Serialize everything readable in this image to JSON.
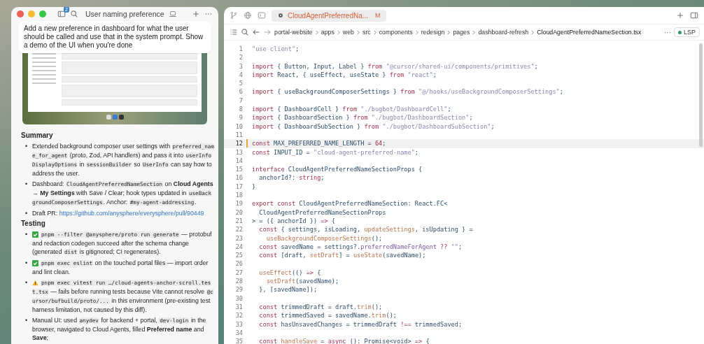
{
  "chat_window": {
    "title": "User naming preference",
    "badge": "2",
    "prompt": "Add a new preference in dashboard for what the user should be called and use that in the system prompt. Show a demo of the UI when you're done",
    "sections": [
      {
        "heading": "Summary",
        "items": [
          {
            "kind": "plain",
            "bullet": "•",
            "segments": [
              {
                "kind": "text",
                "text": "Extended background composer user settings with "
              },
              {
                "kind": "code",
                "text": "preferred_name_for_agent"
              },
              {
                "kind": "text",
                "text": " (proto, Zod, API handlers) and pass it into "
              },
              {
                "kind": "code",
                "text": "userInfoDisplayOptions"
              },
              {
                "kind": "text",
                "text": " in "
              },
              {
                "kind": "code",
                "text": "sessionBuilder"
              },
              {
                "kind": "text",
                "text": " so "
              },
              {
                "kind": "code",
                "text": "UserInfo"
              },
              {
                "kind": "text",
                "text": " can say how to address the user."
              }
            ]
          },
          {
            "kind": "plain",
            "bullet": "•",
            "segments": [
              {
                "kind": "text",
                "text": "Dashboard: "
              },
              {
                "kind": "code",
                "text": "CloudAgentPreferredNameSection"
              },
              {
                "kind": "text",
                "text": " on "
              },
              {
                "kind": "bold",
                "text": "Cloud Agents → My Settings"
              },
              {
                "kind": "text",
                "text": " with Save / Clear; hook types updated in "
              },
              {
                "kind": "code",
                "text": "useBackgroundComposerSettings"
              },
              {
                "kind": "text",
                "text": ". Anchor: "
              },
              {
                "kind": "code",
                "text": "#my-agent-addressing"
              },
              {
                "kind": "text",
                "text": "."
              }
            ]
          },
          {
            "kind": "plain",
            "bullet": "•",
            "segments": [
              {
                "kind": "text",
                "text": "Draft PR: "
              },
              {
                "kind": "link",
                "text": "https://github.com/anysphere/everysphere/pull/90449"
              }
            ]
          }
        ]
      },
      {
        "heading": "Testing",
        "items": [
          {
            "kind": "pass",
            "bullet": "•",
            "segments": [
              {
                "kind": "code",
                "text": "pnpm --filter @anysphere/proto run generate"
              },
              {
                "kind": "text",
                "text": " — protobuf and redaction codegen succeed after the schema change (generated "
              },
              {
                "kind": "code",
                "text": "dist"
              },
              {
                "kind": "text",
                "text": " is gitignored; CI regenerates)."
              }
            ]
          },
          {
            "kind": "pass",
            "bullet": "•",
            "segments": [
              {
                "kind": "code",
                "text": "pnpm exec eslint"
              },
              {
                "kind": "text",
                "text": " on the touched portal files — import order and lint clean."
              }
            ]
          },
          {
            "kind": "warn",
            "bullet": "•",
            "segments": [
              {
                "kind": "code",
                "text": "pnpm exec vitest run …/cloud-agents-anchor-scroll.test.tsx"
              },
              {
                "kind": "text",
                "text": " — fails before running tests because Vite cannot resolve "
              },
              {
                "kind": "code",
                "text": "@cursor/bufbuild/proto/..."
              },
              {
                "kind": "text",
                "text": " in this environment (pre-existing test harness limitation, not caused by this diff)."
              }
            ]
          },
          {
            "kind": "plain",
            "bullet": "•",
            "segments": [
              {
                "kind": "text",
                "text": "Manual UI: used "
              },
              {
                "kind": "code",
                "text": "anydev"
              },
              {
                "kind": "text",
                "text": " for backend + portal, "
              },
              {
                "kind": "code",
                "text": "dev-login"
              },
              {
                "kind": "text",
                "text": " in the browser, navigated to Cloud Agents, filled "
              },
              {
                "kind": "bold",
                "text": "Preferred name"
              },
              {
                "kind": "text",
                "text": " and "
              },
              {
                "kind": "bold",
                "text": "Save"
              },
              {
                "kind": "text",
                "text": ";"
              }
            ]
          }
        ]
      }
    ]
  },
  "editor": {
    "tabs": [
      {
        "label": "CloudAgentPreferredNa...",
        "status": "M",
        "selected": true
      }
    ],
    "breadcrumbs": [
      "portal-website",
      "apps",
      "web",
      "src",
      "components",
      "redesign",
      "pages",
      "dashboard-refresh",
      "CloudAgentPreferredNameSection.tsx"
    ],
    "more": "···",
    "lsp": {
      "label": "LSP",
      "color": "#2e9a6a"
    },
    "lines": [
      {
        "number": "1",
        "selected": false,
        "tokens": [
          {
            "kind": "str",
            "text": "\"use client\""
          },
          {
            "kind": "p",
            "text": ";"
          }
        ]
      },
      {
        "number": "2",
        "selected": false
      },
      {
        "number": "3",
        "selected": false,
        "tokens": [
          {
            "kind": "kw",
            "text": "import"
          },
          {
            "kind": "p",
            "text": " { Button, Input, Label } "
          },
          {
            "kind": "kw",
            "text": "from "
          },
          {
            "kind": "str",
            "text": "\"@cursor/shared-ui/components/primitives\""
          },
          {
            "kind": "p",
            "text": ";"
          }
        ]
      },
      {
        "number": "4",
        "selected": false,
        "tokens": [
          {
            "kind": "kw",
            "text": "import"
          },
          {
            "kind": "p",
            "text": " React, { useEffect, useState } "
          },
          {
            "kind": "kw",
            "text": "from "
          },
          {
            "kind": "str",
            "text": "\"react\""
          },
          {
            "kind": "p",
            "text": ";"
          }
        ]
      },
      {
        "number": "5",
        "selected": false
      },
      {
        "number": "6",
        "selected": false,
        "tokens": [
          {
            "kind": "kw",
            "text": "import"
          },
          {
            "kind": "p",
            "text": " { useBackgroundComposerSettings } "
          },
          {
            "kind": "kw",
            "text": "from "
          },
          {
            "kind": "str",
            "text": "\"@/hooks/useBackgroundComposerSettings\""
          },
          {
            "kind": "p",
            "text": ";"
          }
        ]
      },
      {
        "number": "7",
        "selected": false
      },
      {
        "number": "8",
        "selected": false,
        "tokens": [
          {
            "kind": "kw",
            "text": "import"
          },
          {
            "kind": "p",
            "text": " { DashboardCell } "
          },
          {
            "kind": "kw",
            "text": "from "
          },
          {
            "kind": "str",
            "text": "\"./bugbot/DashboardCell\""
          },
          {
            "kind": "p",
            "text": ";"
          }
        ]
      },
      {
        "number": "9",
        "selected": false,
        "tokens": [
          {
            "kind": "kw",
            "text": "import"
          },
          {
            "kind": "p",
            "text": " { DashboardSection } "
          },
          {
            "kind": "kw",
            "text": "from "
          },
          {
            "kind": "str",
            "text": "\"./bugbot/DashboardSection\""
          },
          {
            "kind": "p",
            "text": ";"
          }
        ]
      },
      {
        "number": "10",
        "selected": false,
        "tokens": [
          {
            "kind": "kw",
            "text": "import"
          },
          {
            "kind": "p",
            "text": " { DashboardSubSection } "
          },
          {
            "kind": "kw",
            "text": "from "
          },
          {
            "kind": "str",
            "text": "\"./bugbot/DashboardSubSection\""
          },
          {
            "kind": "p",
            "text": ";"
          }
        ]
      },
      {
        "number": "11",
        "selected": false
      },
      {
        "number": "12",
        "selected": true,
        "tokens": [
          {
            "kind": "kw",
            "text": "const"
          },
          {
            "kind": "p",
            "text": " MAX_PREFERRED_NAME_LENGTH = "
          },
          {
            "kind": "num",
            "text": "64"
          },
          {
            "kind": "p",
            "text": ";"
          }
        ]
      },
      {
        "number": "13",
        "selected": false,
        "tokens": [
          {
            "kind": "kw",
            "text": "const"
          },
          {
            "kind": "p",
            "text": " INPUT_ID = "
          },
          {
            "kind": "str",
            "text": "\"cloud-agent-preferred-name\""
          },
          {
            "kind": "p",
            "text": ";"
          }
        ]
      },
      {
        "number": "14",
        "selected": false
      },
      {
        "number": "15",
        "selected": false,
        "tokens": [
          {
            "kind": "kw",
            "text": "interface"
          },
          {
            "kind": "p",
            "text": " CloudAgentPreferredNameSectionProps {"
          }
        ]
      },
      {
        "number": "16",
        "selected": false,
        "tokens": [
          {
            "kind": "p",
            "text": "  anchorId?: "
          },
          {
            "kind": "kw",
            "text": "string"
          },
          {
            "kind": "p",
            "text": ";"
          }
        ]
      },
      {
        "number": "17",
        "selected": false,
        "tokens": [
          {
            "kind": "p",
            "text": "}"
          }
        ]
      },
      {
        "number": "18",
        "selected": false
      },
      {
        "number": "19",
        "selected": false,
        "tokens": [
          {
            "kind": "kw",
            "text": "export const"
          },
          {
            "kind": "p",
            "text": " CloudAgentPreferredNameSection: React.FC<"
          }
        ]
      },
      {
        "number": "20",
        "selected": false,
        "tokens": [
          {
            "kind": "p",
            "text": "  CloudAgentPreferredNameSectionProps"
          }
        ]
      },
      {
        "number": "21",
        "selected": false,
        "tokens": [
          {
            "kind": "p",
            "text": "> = ({ anchorId }) "
          },
          {
            "kind": "kw",
            "text": "=>"
          },
          {
            "kind": "p",
            "text": " {"
          }
        ]
      },
      {
        "number": "22",
        "selected": false,
        "tokens": [
          {
            "kind": "kw",
            "text": "  const"
          },
          {
            "kind": "p",
            "text": " { settings, isLoading, "
          },
          {
            "kind": "fn",
            "text": "updateSettings"
          },
          {
            "kind": "p",
            "text": ", isUpdating } ="
          }
        ]
      },
      {
        "number": "23",
        "selected": false,
        "tokens": [
          {
            "kind": "fn",
            "text": "    useBackgroundComposerSettings"
          },
          {
            "kind": "p",
            "text": "();"
          }
        ]
      },
      {
        "number": "24",
        "selected": false,
        "tokens": [
          {
            "kind": "kw",
            "text": "  const"
          },
          {
            "kind": "p",
            "text": " savedName = settings?."
          },
          {
            "kind": "prop",
            "text": "preferredNameForAgent"
          },
          {
            "kind": "kw",
            "text": " ?? "
          },
          {
            "kind": "str",
            "text": "\"\""
          },
          {
            "kind": "p",
            "text": ";"
          }
        ]
      },
      {
        "number": "25",
        "selected": false,
        "tokens": [
          {
            "kind": "kw",
            "text": "  const"
          },
          {
            "kind": "p",
            "text": " [draft, "
          },
          {
            "kind": "fn",
            "text": "setDraft"
          },
          {
            "kind": "p",
            "text": "] = "
          },
          {
            "kind": "fn",
            "text": "useState"
          },
          {
            "kind": "p",
            "text": "(savedName);"
          }
        ]
      },
      {
        "number": "26",
        "selected": false
      },
      {
        "number": "27",
        "selected": false,
        "tokens": [
          {
            "kind": "fn",
            "text": "  useEffect"
          },
          {
            "kind": "p",
            "text": "(() "
          },
          {
            "kind": "kw",
            "text": "=>"
          },
          {
            "kind": "p",
            "text": " {"
          }
        ]
      },
      {
        "number": "28",
        "selected": false,
        "tokens": [
          {
            "kind": "fn",
            "text": "    setDraft"
          },
          {
            "kind": "p",
            "text": "(savedName);"
          }
        ]
      },
      {
        "number": "29",
        "selected": false,
        "tokens": [
          {
            "kind": "p",
            "text": "  }, [savedName]);"
          }
        ]
      },
      {
        "number": "30",
        "selected": false
      },
      {
        "number": "31",
        "selected": false,
        "tokens": [
          {
            "kind": "kw",
            "text": "  const"
          },
          {
            "kind": "p",
            "text": " trimmedDraft = draft."
          },
          {
            "kind": "fn",
            "text": "trim"
          },
          {
            "kind": "p",
            "text": "();"
          }
        ]
      },
      {
        "number": "32",
        "selected": false,
        "tokens": [
          {
            "kind": "kw",
            "text": "  const"
          },
          {
            "kind": "p",
            "text": " trimmedSaved = savedName."
          },
          {
            "kind": "fn",
            "text": "trim"
          },
          {
            "kind": "p",
            "text": "();"
          }
        ]
      },
      {
        "number": "33",
        "selected": false,
        "tokens": [
          {
            "kind": "kw",
            "text": "  const"
          },
          {
            "kind": "p",
            "text": " hasUnsavedChanges = trimmedDraft "
          },
          {
            "kind": "kw",
            "text": "!=="
          },
          {
            "kind": "p",
            "text": " trimmedSaved;"
          }
        ]
      },
      {
        "number": "34",
        "selected": false
      },
      {
        "number": "35",
        "selected": false,
        "tokens": [
          {
            "kind": "kw",
            "text": "  const"
          },
          {
            "kind": "fn",
            "text": " handleSave"
          },
          {
            "kind": "p",
            "text": " = "
          },
          {
            "kind": "kw",
            "text": "async"
          },
          {
            "kind": "p",
            "text": " (): Promise<void> "
          },
          {
            "kind": "kw",
            "text": "=>"
          },
          {
            "kind": "p",
            "text": " {"
          }
        ]
      }
    ]
  }
}
